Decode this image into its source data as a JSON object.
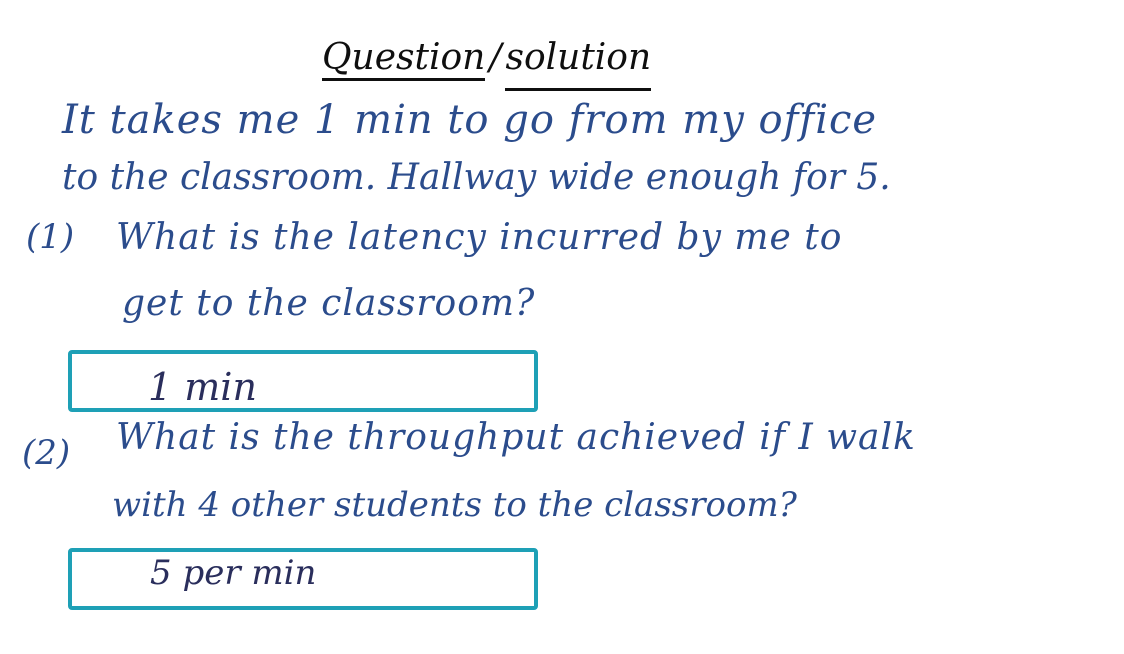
{
  "title": {
    "part1": "Question",
    "separator": "/",
    "part2": "solution"
  },
  "intro": {
    "line1": "It takes me 1 min to go from my office",
    "line2": "to the classroom. Hallway wide enough for 5."
  },
  "question1": {
    "number": "(1)",
    "line1": "What is the latency incurred by me to",
    "line2": "get to the classroom?",
    "answer": "1 min"
  },
  "question2": {
    "number": "(2)",
    "line1": "What is the throughput achieved if I walk",
    "line2": "with 4 other students to the classroom?",
    "answer": "5 per min"
  },
  "colors": {
    "ink": "#2b4c8c",
    "title_ink": "#0f0f0f",
    "box_border": "#1ea0b6"
  }
}
